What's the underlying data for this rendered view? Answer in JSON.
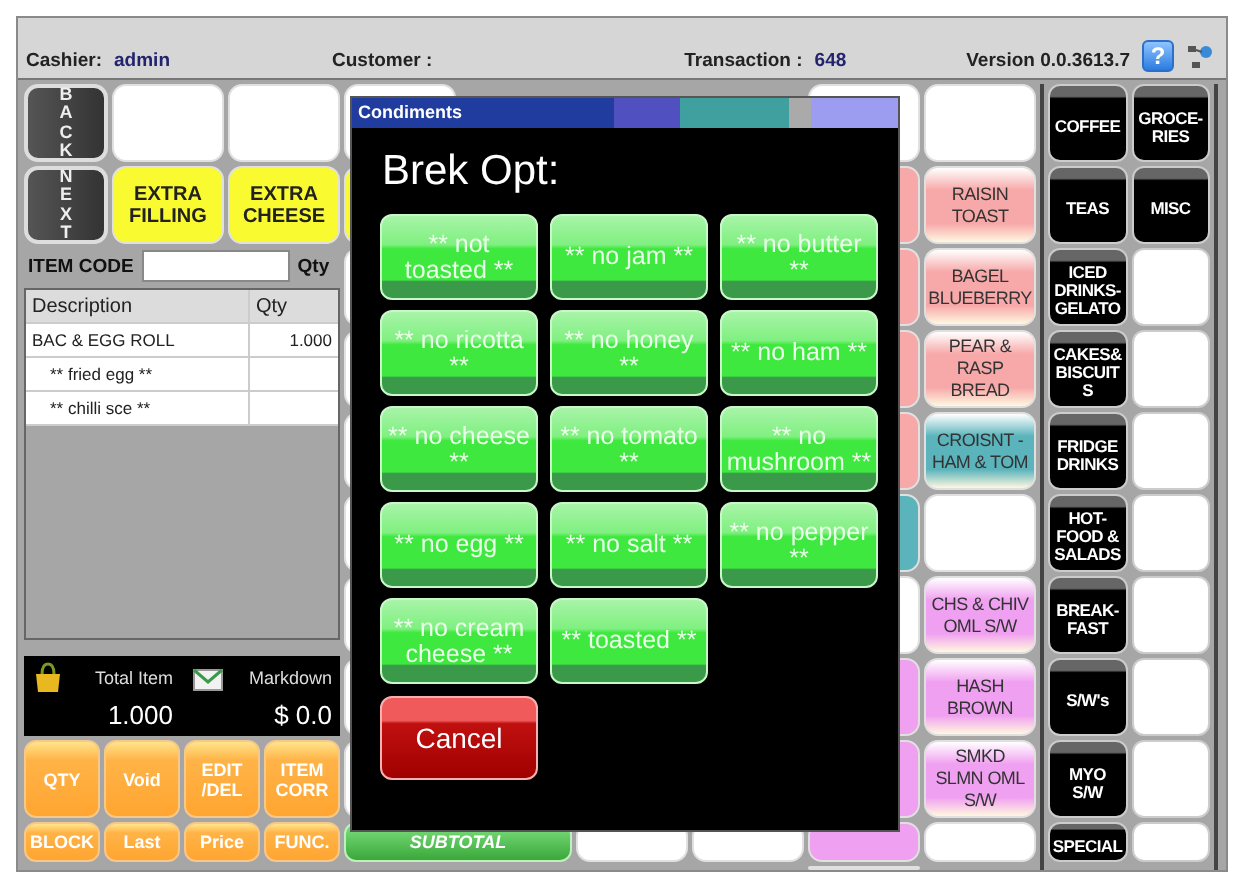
{
  "header": {
    "cashier_label": "Cashier:",
    "cashier": "admin",
    "customer_label": "Customer :",
    "transaction_label": "Transaction :",
    "transaction": "648",
    "version": "Version 0.0.3613.7",
    "help": "?"
  },
  "nav_keys": [
    "BACK",
    "NEXT"
  ],
  "extra_keys": [
    "EXTRA FILLING",
    "EXTRA CHEESE"
  ],
  "products": [
    {
      "kind": "blank"
    },
    {
      "kind": "product",
      "label": "RAISIN TOAST",
      "color": "#f7a8a8"
    },
    {
      "kind": "product",
      "label": "BAGEL BLUEBERRY",
      "color": "#f7a8a8"
    },
    {
      "kind": "product",
      "label": "PEAR & RASP BREAD",
      "color": "#f7a8a8"
    },
    {
      "kind": "product",
      "label": "CROISNT - HAM & TOM",
      "color": "#5bb4bc"
    },
    {
      "kind": "blank"
    },
    {
      "kind": "product",
      "label": "CHS & CHIV OML S/W",
      "color": "#f0a0f0"
    },
    {
      "kind": "product",
      "label": "HASH BROWN",
      "color": "#f0a0f0"
    },
    {
      "kind": "product",
      "label": "SMKD SLMN OML S/W",
      "color": "#f0a0f0"
    },
    {
      "kind": "blank"
    }
  ],
  "item_code": {
    "label": "ITEM CODE",
    "qty_label": "Qty"
  },
  "order_table": {
    "columns": [
      "Description",
      "Qty"
    ],
    "rows": [
      {
        "description": "BAC & EGG ROLL",
        "qty": "1.000",
        "children": [
          {
            "description": "** fried egg **"
          },
          {
            "description": "** chilli sce **"
          }
        ]
      }
    ]
  },
  "totals": [
    {
      "kind": "items",
      "label": "Total Item",
      "value": "1.000"
    },
    {
      "kind": "markdown",
      "label": "Markdown",
      "value": "$ 0.0"
    }
  ],
  "function_keys": [
    "QTY",
    "Void",
    "EDIT /DEL",
    "ITEM CORR",
    "BLOCK",
    "Last",
    "Price",
    "FUNC."
  ],
  "subtotal": "SUBTOTAL",
  "categories": [
    {
      "kind": "category",
      "label": "COFFEE"
    },
    {
      "kind": "category",
      "label": "GROCE-RIES"
    },
    {
      "kind": "category",
      "label": "TEAS"
    },
    {
      "kind": "category",
      "label": "MISC"
    },
    {
      "kind": "category",
      "label": "ICED DRINKS-GELATO"
    },
    {
      "kind": "blank"
    },
    {
      "kind": "category",
      "label": "CAKES& BISCUITS"
    },
    {
      "kind": "blank"
    },
    {
      "kind": "category",
      "label": "FRIDGE DRINKS"
    },
    {
      "kind": "blank"
    },
    {
      "kind": "category",
      "label": "HOT-FOOD & SALADS"
    },
    {
      "kind": "blank"
    },
    {
      "kind": "category",
      "label": "BREAK-FAST"
    },
    {
      "kind": "blank"
    },
    {
      "kind": "category",
      "label": "S/W's"
    },
    {
      "kind": "blank"
    },
    {
      "kind": "category",
      "label": "MYO S/W"
    },
    {
      "kind": "blank"
    },
    {
      "kind": "category",
      "label": "SPECIAL"
    },
    {
      "kind": "blank"
    }
  ],
  "dialog": {
    "title": "Condiments",
    "heading": "Brek Opt:",
    "options": [
      "** not toasted **",
      "** no jam **",
      "** no butter **",
      "** no ricotta **",
      "** no honey **",
      "** no ham **",
      "** no cheese **",
      "** no tomato **",
      "** no mushroom **",
      "** no egg **",
      "** no salt **",
      "** no pepper **",
      "** no cream cheese **",
      "** toasted **"
    ],
    "cancel": "Cancel"
  }
}
